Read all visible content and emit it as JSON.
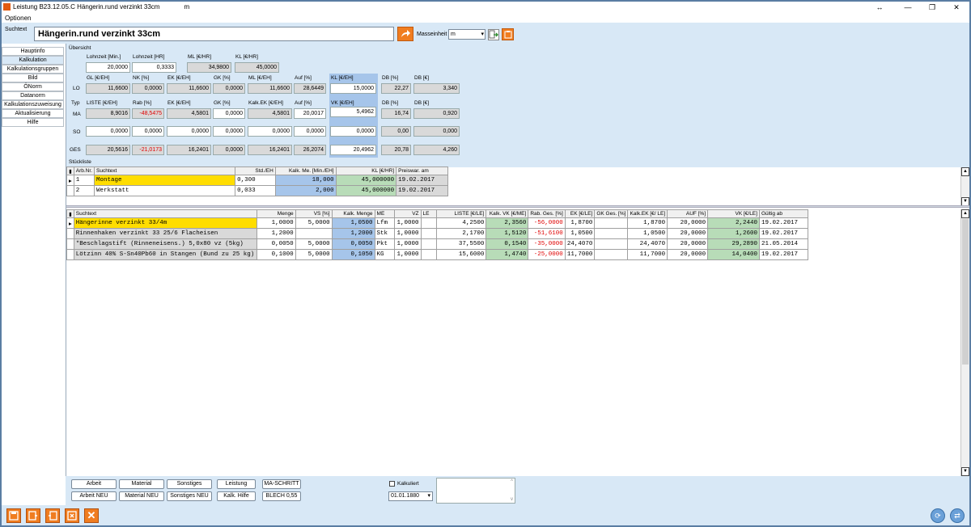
{
  "window": {
    "title": "Leistung B23.12.05.C Hängerin.rund verzinkt 33cm",
    "title_unit": "m",
    "icon_pin": "↔",
    "icon_min": "—",
    "icon_max": "❐",
    "icon_close": "✕"
  },
  "menu": {
    "options": "Optionen"
  },
  "search": {
    "label": "Suchtext",
    "value": "Hängerin.rund verzinkt 33cm",
    "unit_label": "Masseinheit",
    "unit_value": "m"
  },
  "nav": [
    "Hauptinfo",
    "Kalkulation",
    "Kalkulationsgruppen",
    "Bild",
    "ÖNorm",
    "Datanorm",
    "Kalkulationszuweisung",
    "Aktualisierung",
    "Hilfe"
  ],
  "overview": {
    "section": "Übersicht",
    "row0": {
      "labels": [
        "Lohnzeit [Min.]",
        "Lohnzeit [HR]",
        "ML [€/HR]",
        "KL [€/HR]"
      ],
      "values": [
        "20,0000",
        "0,3333",
        "34,9800",
        "45,0000"
      ]
    },
    "headers1": [
      "GL [€/EH]",
      "NK [%]",
      "EK [€/EH]",
      "GK [%]",
      "ML [€/EH]",
      "Auf [%]",
      "KL [€/EH]",
      "DB [%]",
      "DB [€]"
    ],
    "headers2": [
      "LISTE [€/EH]",
      "Rab [%]",
      "EK [€/EH]",
      "GK [%]",
      "Kalk.EK [€/EH]",
      "Auf [%]",
      "VK [€/EH]",
      "DB [%]",
      "DB [€]"
    ],
    "typ_label": "Typ",
    "rows": [
      {
        "label": "LO",
        "values": [
          "11,6600",
          "0,0000",
          "11,6600",
          "0,0000",
          "11,6600",
          "28,6449",
          "15,0000",
          "22,27",
          "3,340"
        ]
      },
      {
        "label": "MA",
        "values": [
          "8,9016",
          "-48,5475",
          "4,5801",
          "0,0000",
          "4,5801",
          "20,0017",
          "5,4962",
          "16,74",
          "0,920"
        ]
      },
      {
        "label": "SO",
        "values": [
          "0,0000",
          "0,0000",
          "0,0000",
          "0,0000",
          "0,0000",
          "0,0000",
          "0,0000",
          "0,00",
          "0,000"
        ]
      },
      {
        "label": "GES",
        "values": [
          "20,5616",
          "-21,0173",
          "16,2401",
          "0,0000",
          "16,2401",
          "26,2074",
          "20,4962",
          "20,78",
          "4,260"
        ]
      }
    ]
  },
  "stueckliste": {
    "title": "Stückliste",
    "headers": [
      "Arb.Nr.",
      "Suchtext",
      "Std./EH",
      "Kalk. Me. [Min./EH]",
      "KL [€/HR]",
      "Preiswar. am"
    ],
    "rows": [
      [
        "1",
        "Montage",
        "0,300",
        "18,000",
        "45,000000",
        "19.02.2017"
      ],
      [
        "2",
        "Werkstatt",
        "0,033",
        "2,000",
        "45,000000",
        "19.02.2017"
      ]
    ]
  },
  "materials": {
    "headers": [
      "Suchtext",
      "Menge",
      "VS [%]",
      "Kalk. Menge",
      "ME",
      "VZ",
      "LE",
      "LISTE [€/LE]",
      "Kalk. VK [€/ME]",
      "Rab. Ges. [%]",
      "EK [€/LE]",
      "GK Ges. [%]",
      "Kalk.EK [€/ LE]",
      "AUF [%]",
      "VK [€/LE]",
      "Gültig ab"
    ],
    "rows": [
      [
        "Hängerinne verzinkt 33/4m",
        "1,0000",
        "5,0000",
        "1,0500",
        "Lfm",
        "1,0000",
        "",
        "4,2500",
        "2,3560",
        "-56,0000",
        "1,8700",
        "",
        "1,8700",
        "20,0000",
        "2,2440",
        "19.02.2017"
      ],
      [
        "Rinnenhaken verzinkt 33 25/6 Flacheisen",
        "1,2000",
        "",
        "1,2000",
        "Stk",
        "1,0000",
        "",
        "2,1700",
        "1,5120",
        "-51,6100",
        "1,0500",
        "",
        "1,0500",
        "20,0000",
        "1,2600",
        "19.02.2017"
      ],
      [
        "*Beschlagstift (Rinneneisens.) 5,0x80 vz (5kg)",
        "0,0050",
        "5,0000",
        "0,0050",
        "Pkt",
        "1,0000",
        "",
        "37,5500",
        "0,1540",
        "-35,0000",
        "24,4070",
        "",
        "24,4070",
        "20,0000",
        "29,2890",
        "21.05.2014"
      ],
      [
        "Lötzinn 40% S-Sn40Pb60 in Stangen (Bund zu 25 kg)",
        "0,1000",
        "5,0000",
        "0,1050",
        "KG",
        "1,0000",
        "",
        "15,6000",
        "1,4740",
        "-25,0000",
        "11,7000",
        "",
        "11,7000",
        "20,0000",
        "14,0400",
        "19.02.2017"
      ]
    ]
  },
  "buttons": {
    "row1": [
      "Arbeit",
      "Material",
      "Sonstiges",
      "Leistung",
      "MA-SCHRITT"
    ],
    "row2": [
      "Arbeit NEU",
      "Material NEU",
      "Sonstiges NEU",
      "Kalk. Hilfe",
      "BLECH 0,55"
    ],
    "kalkuliert": "Kalkuliert",
    "date": "01.01.1880"
  },
  "colors": {
    "accent": "#f07d20",
    "panel": "#d8e8f6",
    "highlight_blue": "#a6c5ea",
    "highlight_green": "#b8dcb8",
    "highlight_yellow": "#ffdd00",
    "negative": "#e00000"
  }
}
